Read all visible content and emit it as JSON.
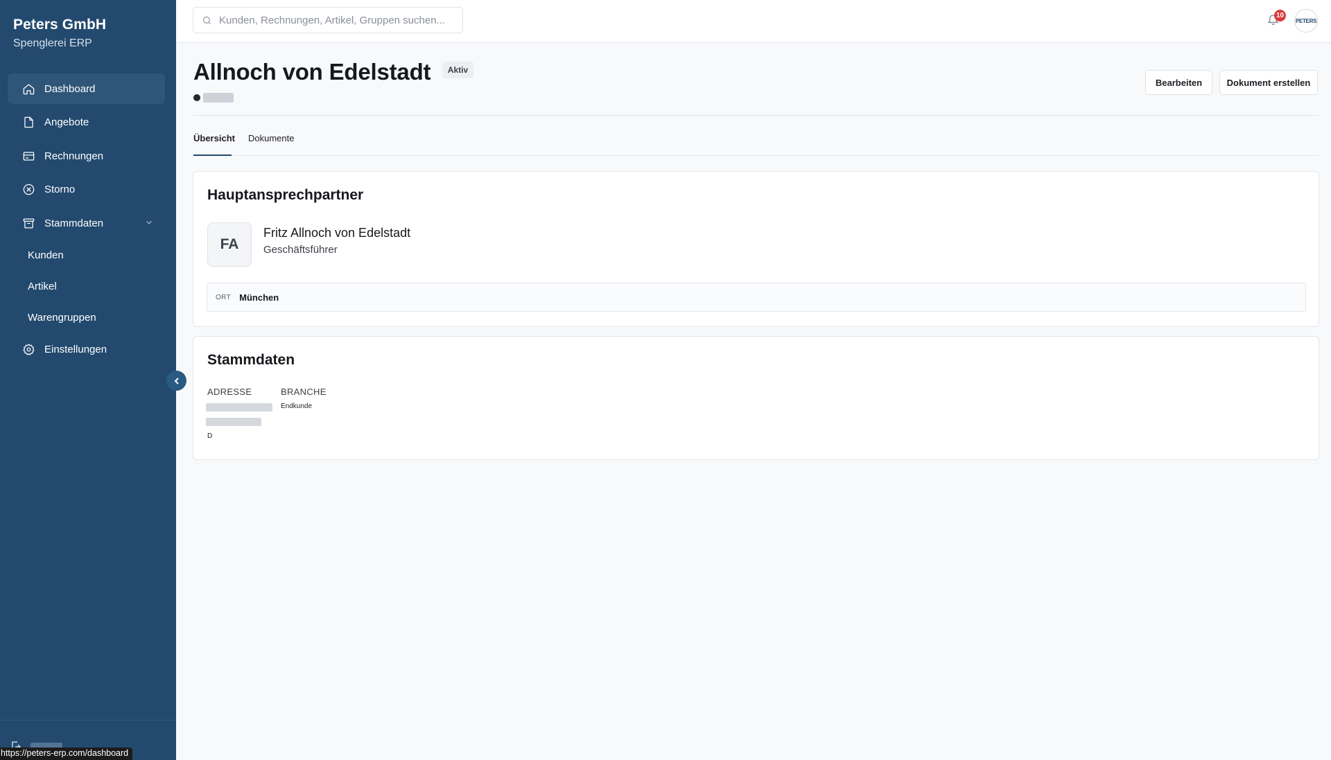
{
  "sidebar": {
    "brand_title": "Peters GmbH",
    "brand_subtitle": "Spenglerei ERP",
    "items": [
      {
        "label": "Dashboard",
        "icon": "home-icon",
        "active": true
      },
      {
        "label": "Angebote",
        "icon": "document-icon"
      },
      {
        "label": "Rechnungen",
        "icon": "credit-card-icon"
      },
      {
        "label": "Storno",
        "icon": "x-circle-icon"
      },
      {
        "label": "Stammdaten",
        "icon": "archive-icon",
        "expanded": true
      }
    ],
    "sub_items": [
      {
        "label": "Kunden"
      },
      {
        "label": "Artikel"
      },
      {
        "label": "Warengruppen"
      }
    ],
    "settings_label": "Einstellungen",
    "status_url": "https://peters-erp.com/dashboard"
  },
  "topbar": {
    "search_placeholder": "Kunden, Rechnungen, Artikel, Gruppen suchen...",
    "notification_count": "10",
    "avatar_text": "PETERS"
  },
  "page": {
    "title": "Allnoch von Edelstadt",
    "status_badge": "Aktiv",
    "edit_label": "Bearbeiten",
    "create_doc_label": "Dokument erstellen",
    "tabs": [
      {
        "label": "Übersicht",
        "active": true
      },
      {
        "label": "Dokumente"
      }
    ]
  },
  "contact_card": {
    "title": "Hauptansprechpartner",
    "initials": "FA",
    "name": "Fritz Allnoch von Edelstadt",
    "role": "Geschäftsführer",
    "location_key": "ORT",
    "location_value": "München"
  },
  "master_card": {
    "title": "Stammdaten",
    "address_label": "ADRESSE",
    "address_country": "D",
    "industry_label": "BRANCHE",
    "industry_value": "Endkunde"
  },
  "colors": {
    "sidebar_bg": "#234a6e",
    "accent": "#234a6e",
    "badge_red": "#d93a3a"
  }
}
